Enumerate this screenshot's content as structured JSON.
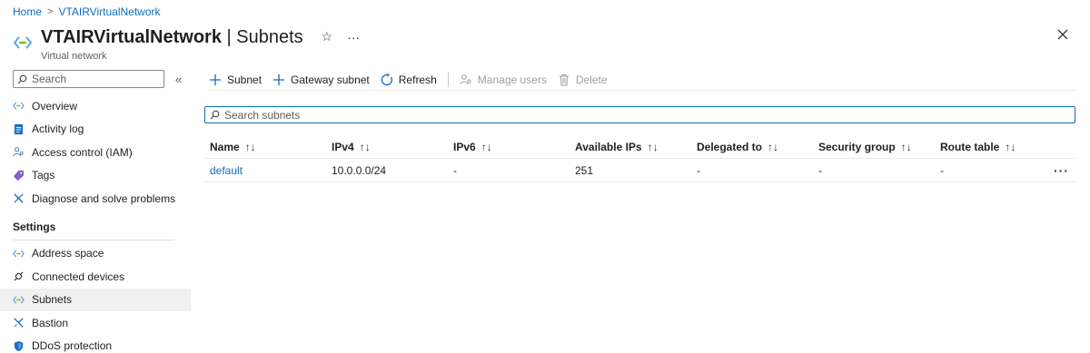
{
  "breadcrumb": {
    "home": "Home",
    "sep": ">",
    "current": "VTAIRVirtualNetwork"
  },
  "header": {
    "title_bold": "VTAIRVirtualNetwork",
    "title_rest": " | Subnets",
    "subtitle": "Virtual network",
    "star": "☆",
    "more": "···"
  },
  "sidebar": {
    "search_placeholder": "Search",
    "collapse": "«",
    "items": [
      {
        "label": "Overview",
        "icon": "vnet-icon"
      },
      {
        "label": "Activity log",
        "icon": "activity-log-icon"
      },
      {
        "label": "Access control (IAM)",
        "icon": "iam-icon"
      },
      {
        "label": "Tags",
        "icon": "tag-icon"
      },
      {
        "label": "Diagnose and solve problems",
        "icon": "wrench-icon"
      }
    ],
    "settings_label": "Settings",
    "settings_items": [
      {
        "label": "Address space",
        "icon": "vnet-icon"
      },
      {
        "label": "Connected devices",
        "icon": "plug-icon"
      },
      {
        "label": "Subnets",
        "icon": "vnet-icon"
      },
      {
        "label": "Bastion",
        "icon": "bastion-icon"
      },
      {
        "label": "DDoS protection",
        "icon": "shield-icon"
      }
    ]
  },
  "toolbar": {
    "subnet": "Subnet",
    "gateway_subnet": "Gateway subnet",
    "refresh": "Refresh",
    "manage_users": "Manage users",
    "delete": "Delete"
  },
  "search": {
    "placeholder": "Search subnets"
  },
  "table": {
    "columns": [
      "Name",
      "IPv4",
      "IPv6",
      "Available IPs",
      "Delegated to",
      "Security group",
      "Route table"
    ],
    "sort_glyph": "↑↓",
    "rows": [
      {
        "name": "default",
        "ipv4": "10.0.0.0/24",
        "ipv6": "-",
        "available": "251",
        "delegated": "-",
        "security": "-",
        "route": "-",
        "more": "···"
      }
    ]
  },
  "colors": {
    "accent": "#0f6cbd",
    "text": "#201f1e",
    "muted": "#605e5c",
    "disabled": "#a19f9d"
  }
}
